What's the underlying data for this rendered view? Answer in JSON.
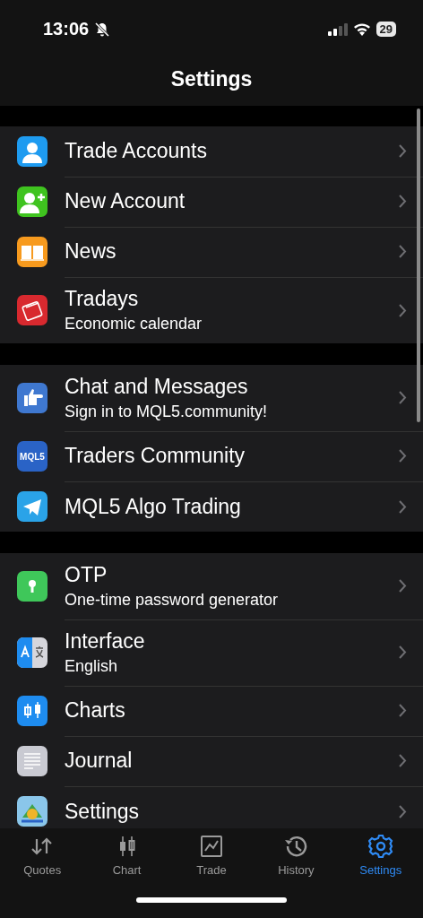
{
  "status_bar": {
    "time": "13:06",
    "battery": "29"
  },
  "header": {
    "title": "Settings"
  },
  "sections": [
    {
      "items": [
        {
          "title": "Trade Accounts"
        },
        {
          "title": "New Account"
        },
        {
          "title": "News"
        },
        {
          "title": "Tradays",
          "subtitle": "Economic calendar"
        }
      ]
    },
    {
      "items": [
        {
          "title": "Chat and Messages",
          "subtitle": "Sign in to MQL5.community!"
        },
        {
          "title": "Traders Community",
          "icon_text": "MQL5"
        },
        {
          "title": "MQL5 Algo Trading"
        }
      ]
    },
    {
      "items": [
        {
          "title": "OTP",
          "subtitle": "One-time password generator"
        },
        {
          "title": "Interface",
          "subtitle": "English"
        },
        {
          "title": "Charts"
        },
        {
          "title": "Journal"
        },
        {
          "title": "Settings"
        }
      ]
    }
  ],
  "tab_bar": [
    {
      "label": "Quotes",
      "selected": false
    },
    {
      "label": "Chart",
      "selected": false
    },
    {
      "label": "Trade",
      "selected": false
    },
    {
      "label": "History",
      "selected": false
    },
    {
      "label": "Settings",
      "selected": true
    }
  ]
}
